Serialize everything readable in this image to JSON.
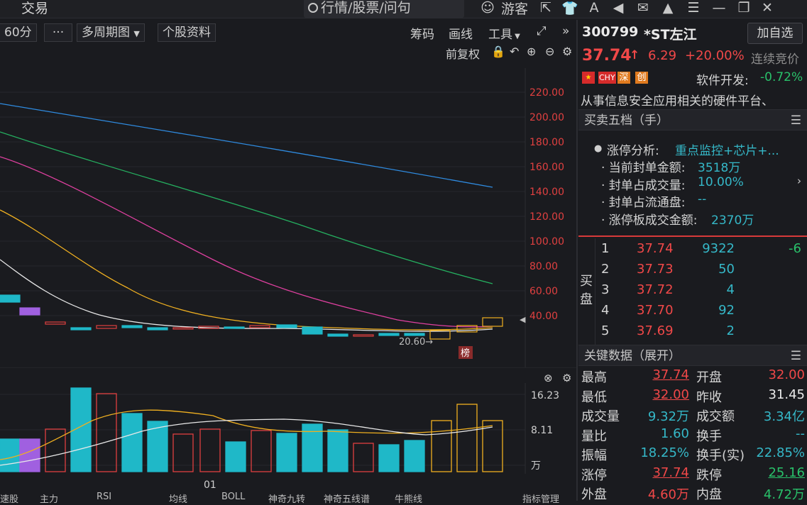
{
  "top": {
    "title": "交易",
    "search_placeholder": "行情/股票/问句",
    "guest_label": "游客"
  },
  "toolbar": {
    "period": "60分",
    "more": "···",
    "multi_period": "多周期图",
    "stock_info": "个股资料",
    "chips": "筹码",
    "draw": "画线",
    "tools": "工具",
    "expand": "»",
    "adjust": "前复权"
  },
  "chart_data": [
    {
      "type": "line",
      "subtype": "candlestick-with-ma",
      "y_ticks": [
        "220.00",
        "200.00",
        "180.00",
        "160.00",
        "140.00",
        "120.00",
        "100.00",
        "80.00",
        "60.00",
        "40.00"
      ],
      "ylim": [
        20,
        225
      ],
      "annotation_low": "20.60→",
      "badge": "榜"
    },
    {
      "type": "bar",
      "subtype": "volume",
      "y_ticks": [
        "16.23",
        "8.11",
        "万"
      ],
      "x_label": "01"
    }
  ],
  "bottom_tabs": [
    "速股",
    "主力",
    "RSI",
    "均线",
    "BOLL",
    "神奇九转",
    "神奇五线谱",
    "牛熊线",
    "指标管理"
  ],
  "quote": {
    "code": "300799",
    "name": "*ST左江",
    "add_watch": "加自选",
    "price": "37.74",
    "arrow": "↑",
    "change": "6.29",
    "change_pct": "+20.00%",
    "status": "连续竞价",
    "tags": [
      "CHY",
      "深",
      "创"
    ],
    "sector": "软件开发:",
    "sector_pct": "-0.72%",
    "desc": "从事信息安全应用相关的硬件平台、"
  },
  "order_book": {
    "header": "买卖五档（手）",
    "limit": {
      "title": "涨停分析:",
      "title_val": "重点监控+芯片+...",
      "rows": [
        {
          "k": "当前封单金额:",
          "v": "3518万"
        },
        {
          "k": "封单占成交量:",
          "v": "10.00%"
        },
        {
          "k": "封单占流通盘:",
          "v": "--"
        },
        {
          "k": "涨停板成交金额:",
          "v": "2370万"
        }
      ]
    },
    "side_label_1": "买",
    "side_label_2": "盘",
    "bids": [
      {
        "lvl": "1",
        "price": "37.74",
        "vol": "9322",
        "chg": "-6"
      },
      {
        "lvl": "2",
        "price": "37.73",
        "vol": "50",
        "chg": ""
      },
      {
        "lvl": "3",
        "price": "37.72",
        "vol": "4",
        "chg": ""
      },
      {
        "lvl": "4",
        "price": "37.70",
        "vol": "92",
        "chg": ""
      },
      {
        "lvl": "5",
        "price": "37.69",
        "vol": "2",
        "chg": ""
      }
    ]
  },
  "key_data": {
    "header": "关键数据（展开）",
    "rows": [
      {
        "k1": "最高",
        "v1": "37.74",
        "k2": "开盘",
        "v2": "32.00"
      },
      {
        "k1": "最低",
        "v1": "32.00",
        "k2": "昨收",
        "v2": "31.45"
      },
      {
        "k1": "成交量",
        "v1": "9.32万",
        "k2": "成交额",
        "v2": "3.34亿"
      },
      {
        "k1": "量比",
        "v1": "1.60",
        "k2": "换手",
        "v2": "--"
      },
      {
        "k1": "振幅",
        "v1": "18.25%",
        "k2": "换手(实)",
        "v2": "22.85%"
      },
      {
        "k1": "涨停",
        "v1": "37.74",
        "k2": "跌停",
        "v2": "25.16"
      },
      {
        "k1": "外盘",
        "v1": "4.60万",
        "k2": "内盘",
        "v2": "4.72万"
      }
    ]
  },
  "colors": {
    "up": "#f04848",
    "down": "#29c16a",
    "cyan": "#35b8c8",
    "bg": "#1a1b1f"
  }
}
